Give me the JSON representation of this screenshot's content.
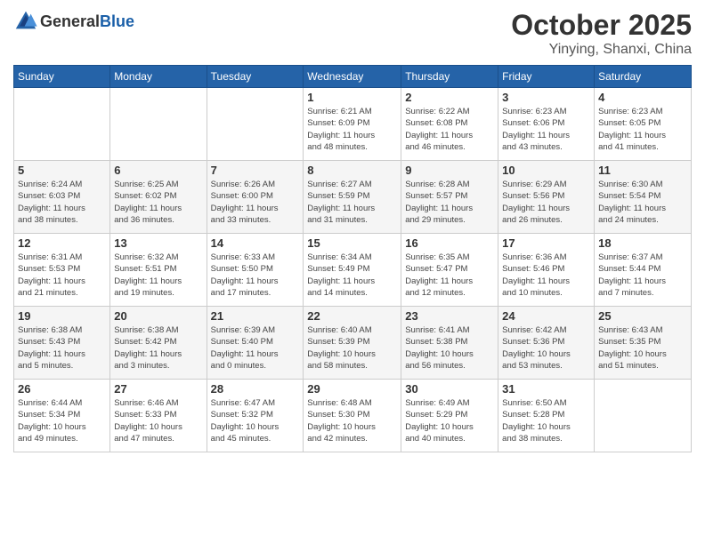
{
  "header": {
    "logo_general": "General",
    "logo_blue": "Blue",
    "month": "October 2025",
    "location": "Yinying, Shanxi, China"
  },
  "weekdays": [
    "Sunday",
    "Monday",
    "Tuesday",
    "Wednesday",
    "Thursday",
    "Friday",
    "Saturday"
  ],
  "weeks": [
    [
      {
        "day": "",
        "info": ""
      },
      {
        "day": "",
        "info": ""
      },
      {
        "day": "",
        "info": ""
      },
      {
        "day": "1",
        "info": "Sunrise: 6:21 AM\nSunset: 6:09 PM\nDaylight: 11 hours\nand 48 minutes."
      },
      {
        "day": "2",
        "info": "Sunrise: 6:22 AM\nSunset: 6:08 PM\nDaylight: 11 hours\nand 46 minutes."
      },
      {
        "day": "3",
        "info": "Sunrise: 6:23 AM\nSunset: 6:06 PM\nDaylight: 11 hours\nand 43 minutes."
      },
      {
        "day": "4",
        "info": "Sunrise: 6:23 AM\nSunset: 6:05 PM\nDaylight: 11 hours\nand 41 minutes."
      }
    ],
    [
      {
        "day": "5",
        "info": "Sunrise: 6:24 AM\nSunset: 6:03 PM\nDaylight: 11 hours\nand 38 minutes."
      },
      {
        "day": "6",
        "info": "Sunrise: 6:25 AM\nSunset: 6:02 PM\nDaylight: 11 hours\nand 36 minutes."
      },
      {
        "day": "7",
        "info": "Sunrise: 6:26 AM\nSunset: 6:00 PM\nDaylight: 11 hours\nand 33 minutes."
      },
      {
        "day": "8",
        "info": "Sunrise: 6:27 AM\nSunset: 5:59 PM\nDaylight: 11 hours\nand 31 minutes."
      },
      {
        "day": "9",
        "info": "Sunrise: 6:28 AM\nSunset: 5:57 PM\nDaylight: 11 hours\nand 29 minutes."
      },
      {
        "day": "10",
        "info": "Sunrise: 6:29 AM\nSunset: 5:56 PM\nDaylight: 11 hours\nand 26 minutes."
      },
      {
        "day": "11",
        "info": "Sunrise: 6:30 AM\nSunset: 5:54 PM\nDaylight: 11 hours\nand 24 minutes."
      }
    ],
    [
      {
        "day": "12",
        "info": "Sunrise: 6:31 AM\nSunset: 5:53 PM\nDaylight: 11 hours\nand 21 minutes."
      },
      {
        "day": "13",
        "info": "Sunrise: 6:32 AM\nSunset: 5:51 PM\nDaylight: 11 hours\nand 19 minutes."
      },
      {
        "day": "14",
        "info": "Sunrise: 6:33 AM\nSunset: 5:50 PM\nDaylight: 11 hours\nand 17 minutes."
      },
      {
        "day": "15",
        "info": "Sunrise: 6:34 AM\nSunset: 5:49 PM\nDaylight: 11 hours\nand 14 minutes."
      },
      {
        "day": "16",
        "info": "Sunrise: 6:35 AM\nSunset: 5:47 PM\nDaylight: 11 hours\nand 12 minutes."
      },
      {
        "day": "17",
        "info": "Sunrise: 6:36 AM\nSunset: 5:46 PM\nDaylight: 11 hours\nand 10 minutes."
      },
      {
        "day": "18",
        "info": "Sunrise: 6:37 AM\nSunset: 5:44 PM\nDaylight: 11 hours\nand 7 minutes."
      }
    ],
    [
      {
        "day": "19",
        "info": "Sunrise: 6:38 AM\nSunset: 5:43 PM\nDaylight: 11 hours\nand 5 minutes."
      },
      {
        "day": "20",
        "info": "Sunrise: 6:38 AM\nSunset: 5:42 PM\nDaylight: 11 hours\nand 3 minutes."
      },
      {
        "day": "21",
        "info": "Sunrise: 6:39 AM\nSunset: 5:40 PM\nDaylight: 11 hours\nand 0 minutes."
      },
      {
        "day": "22",
        "info": "Sunrise: 6:40 AM\nSunset: 5:39 PM\nDaylight: 10 hours\nand 58 minutes."
      },
      {
        "day": "23",
        "info": "Sunrise: 6:41 AM\nSunset: 5:38 PM\nDaylight: 10 hours\nand 56 minutes."
      },
      {
        "day": "24",
        "info": "Sunrise: 6:42 AM\nSunset: 5:36 PM\nDaylight: 10 hours\nand 53 minutes."
      },
      {
        "day": "25",
        "info": "Sunrise: 6:43 AM\nSunset: 5:35 PM\nDaylight: 10 hours\nand 51 minutes."
      }
    ],
    [
      {
        "day": "26",
        "info": "Sunrise: 6:44 AM\nSunset: 5:34 PM\nDaylight: 10 hours\nand 49 minutes."
      },
      {
        "day": "27",
        "info": "Sunrise: 6:46 AM\nSunset: 5:33 PM\nDaylight: 10 hours\nand 47 minutes."
      },
      {
        "day": "28",
        "info": "Sunrise: 6:47 AM\nSunset: 5:32 PM\nDaylight: 10 hours\nand 45 minutes."
      },
      {
        "day": "29",
        "info": "Sunrise: 6:48 AM\nSunset: 5:30 PM\nDaylight: 10 hours\nand 42 minutes."
      },
      {
        "day": "30",
        "info": "Sunrise: 6:49 AM\nSunset: 5:29 PM\nDaylight: 10 hours\nand 40 minutes."
      },
      {
        "day": "31",
        "info": "Sunrise: 6:50 AM\nSunset: 5:28 PM\nDaylight: 10 hours\nand 38 minutes."
      },
      {
        "day": "",
        "info": ""
      }
    ]
  ]
}
